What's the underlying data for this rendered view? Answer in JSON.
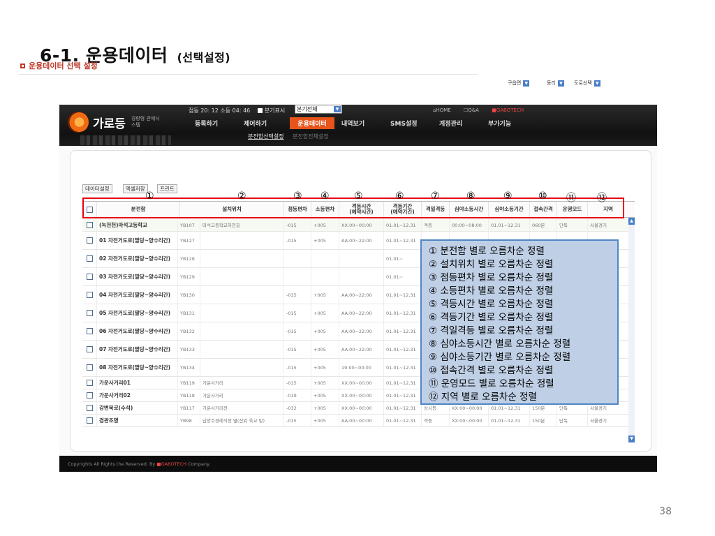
{
  "slide": {
    "title": "6-1. 운용데이터",
    "subtitle": "(선택설정)",
    "page_number": "38"
  },
  "app": {
    "logo_text": "가로등",
    "logo_sub": "경량형 관제시스템",
    "status": "점등 20: 12 소등 04: 46",
    "branch_toggle_label": "분기표시",
    "branch_select_value": "분기전체",
    "top_links": [
      "HOME",
      "Q&A",
      "GABOTECH"
    ],
    "menu": [
      "등록하기",
      "제어하기",
      "운용데이터",
      "내역보기",
      "SMS설정",
      "계정관리",
      "부가기능"
    ],
    "submenu": [
      "분전함선택설정",
      "분전함전체설정"
    ],
    "footer": "Copyrights All Rights the Reserved. By ",
    "footer_brand": "GABOTECH",
    "footer_end": " Company."
  },
  "panel": {
    "section_title": "운용데이터 선택 설정",
    "buttons": [
      "데이터설정",
      "엑셀저장",
      "프린트"
    ],
    "filters": [
      "구읍면",
      "동리",
      "도로선택"
    ]
  },
  "table": {
    "headers": [
      "",
      "분전함",
      "설치위치",
      "점등편차",
      "소등편차",
      "격등시간\n(예약시간)",
      "격등기간\n(예약기간)",
      "격일격등",
      "심야소등시간",
      "심야소등기간",
      "접속간격",
      "운영모드",
      "지역"
    ],
    "rows": [
      [
        "(녹천천)마석고등학교",
        "YB107",
        "마석고등학교하천길",
        "-015",
        "+005",
        "XX:00~00:00",
        "01.01~12.31",
        "격등",
        "00:00~08:00",
        "01.01~12.31",
        "060분",
        "단독",
        "서울경기"
      ],
      [
        "01 자전거도로(팔당~양수리간)",
        "YB127",
        "",
        "-015",
        "+005",
        "AA:00~22:00",
        "01.01~12.31",
        "",
        "",
        "",
        "",
        "",
        ""
      ],
      [
        "02 자전거도로(팔당~양수리간)",
        "YB128",
        "",
        "",
        "",
        "",
        "01.01~",
        "",
        "",
        "",
        "",
        "",
        ""
      ],
      [
        "03 자전거도로(팔당~양수리간)",
        "YB129",
        "",
        "",
        "",
        "",
        "01.01~",
        "",
        "",
        "",
        "",
        "",
        ""
      ],
      [
        "04 자전거도로(팔당~양수리간)",
        "YB130",
        "",
        "-015",
        "+005",
        "AA:00~22:00",
        "01.01~12.31",
        "",
        "",
        "",
        "",
        "",
        ""
      ],
      [
        "05 자전거도로(팔당~양수리간)",
        "YB131",
        "",
        "-015",
        "+005",
        "AA:00~22:00",
        "01.01~12.31",
        "",
        "",
        "",
        "",
        "",
        ""
      ],
      [
        "06 자전거도로(팔당~양수리간)",
        "YB132",
        "",
        "-015",
        "+005",
        "AA:00~22:00",
        "01.01~12.31",
        "",
        "",
        "",
        "",
        "",
        ""
      ],
      [
        "07 자전거도로(팔당~양수리간)",
        "YB133",
        "",
        "-015",
        "+005",
        "AA:00~22:00",
        "01.01~12.31",
        "",
        "",
        "",
        "",
        "",
        ""
      ],
      [
        "08 자전거도로(팔당~양수리간)",
        "YB134",
        "",
        "-015",
        "+005",
        "19:00~00:00",
        "01.01~12.31",
        "",
        "",
        "",
        "",
        "",
        ""
      ],
      [
        "가운사거리01",
        "YB119",
        "가운사거리",
        "-015",
        "+005",
        "XX:00~00:00",
        "01.01~12.31",
        "",
        "",
        "",
        "",
        "",
        ""
      ],
      [
        "가운사거리02",
        "YB118",
        "가운사거리",
        "-019",
        "+005",
        "XX:00~00:00",
        "01.01~12.31",
        "",
        "",
        "",
        "",
        "",
        ""
      ],
      [
        "강변북로(수석)",
        "YB117",
        "가운사거리전",
        "-032",
        "+005",
        "XX:00~00:00",
        "01.01~12.31",
        "상시등",
        "XX:00~00:00",
        "01.01~12.31",
        "150분",
        "단독",
        "서울경기"
      ],
      [
        "경관조명",
        "YB98",
        "남양주경례식장 옆(산위 육교 밑)",
        "-015",
        "+005",
        "AA:00~00:00",
        "01.01~12.31",
        "격등",
        "XX:00~00:00",
        "01.01~12.31",
        "150분",
        "단독",
        "서울경기"
      ]
    ]
  },
  "annotations": {
    "numbers": [
      "①",
      "②",
      "③",
      "④",
      "⑤",
      "⑥",
      "⑦",
      "⑧",
      "⑨",
      "⑩",
      "⑪",
      "⑫"
    ],
    "legend": [
      "① 분전함 별로 오름차순 정렬",
      "② 설치위치 별로 오름차순 정렬",
      "③ 점등편차 별로 오름차순 정렬",
      "④ 소등편차 별로 오름차순 정렬",
      "⑤ 격등시간 별로 오름차순 정렬",
      "⑥ 격등기간 별로 오름차순 정렬",
      "⑦ 격일격등 별로 오름차순 정렬",
      "⑧ 심야소등시간 별로 오름차순 정렬",
      "⑨ 심야소등기간 별로 오름차순 정렬",
      "⑩ 접속간격 별로 오름차순 정렬",
      "⑪ 운영모드 별로 오름차순 정렬",
      "⑫ 지역 별로 오름차순 정렬"
    ]
  },
  "colors": {
    "accent": "#e8541a",
    "annotation_red": "#e8000e",
    "legend_fill": "#bfd0e6",
    "legend_border": "#4f86c6"
  }
}
